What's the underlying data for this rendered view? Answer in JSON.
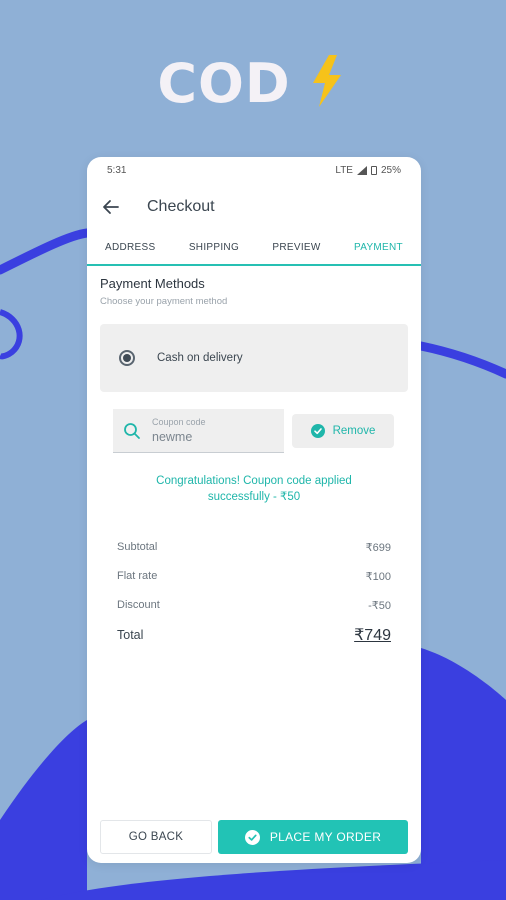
{
  "headline": {
    "text": "COD"
  },
  "colors": {
    "accent": "#22c3b5",
    "background": "#8fb0d6",
    "swoosh": "#3a3fe0",
    "bolt": "#f6c21a"
  },
  "status_bar": {
    "time": "5:31",
    "battery": "25%",
    "network": "LTE"
  },
  "appbar": {
    "title": "Checkout",
    "back_icon": "arrow-left-icon"
  },
  "tabs": [
    {
      "label": "ADDRESS",
      "active": false
    },
    {
      "label": "SHIPPING",
      "active": false
    },
    {
      "label": "PREVIEW",
      "active": false
    },
    {
      "label": "PAYMENT",
      "active": true
    }
  ],
  "payment": {
    "title": "Payment Methods",
    "subtitle": "Choose your payment method",
    "selected_method": "Cash on delivery"
  },
  "coupon": {
    "label": "Coupon code",
    "value": "newme",
    "remove_label": "Remove",
    "message": "Congratulations! Coupon code applied successfully - ₹50"
  },
  "summary": {
    "rows": [
      {
        "label": "Subtotal",
        "value": "₹699"
      },
      {
        "label": "Flat rate",
        "value": "₹100"
      },
      {
        "label": "Discount",
        "value": "-₹50"
      }
    ],
    "total_label": "Total",
    "total_value": "₹749"
  },
  "actions": {
    "go_back": "GO BACK",
    "place_order": "PLACE MY ORDER"
  }
}
